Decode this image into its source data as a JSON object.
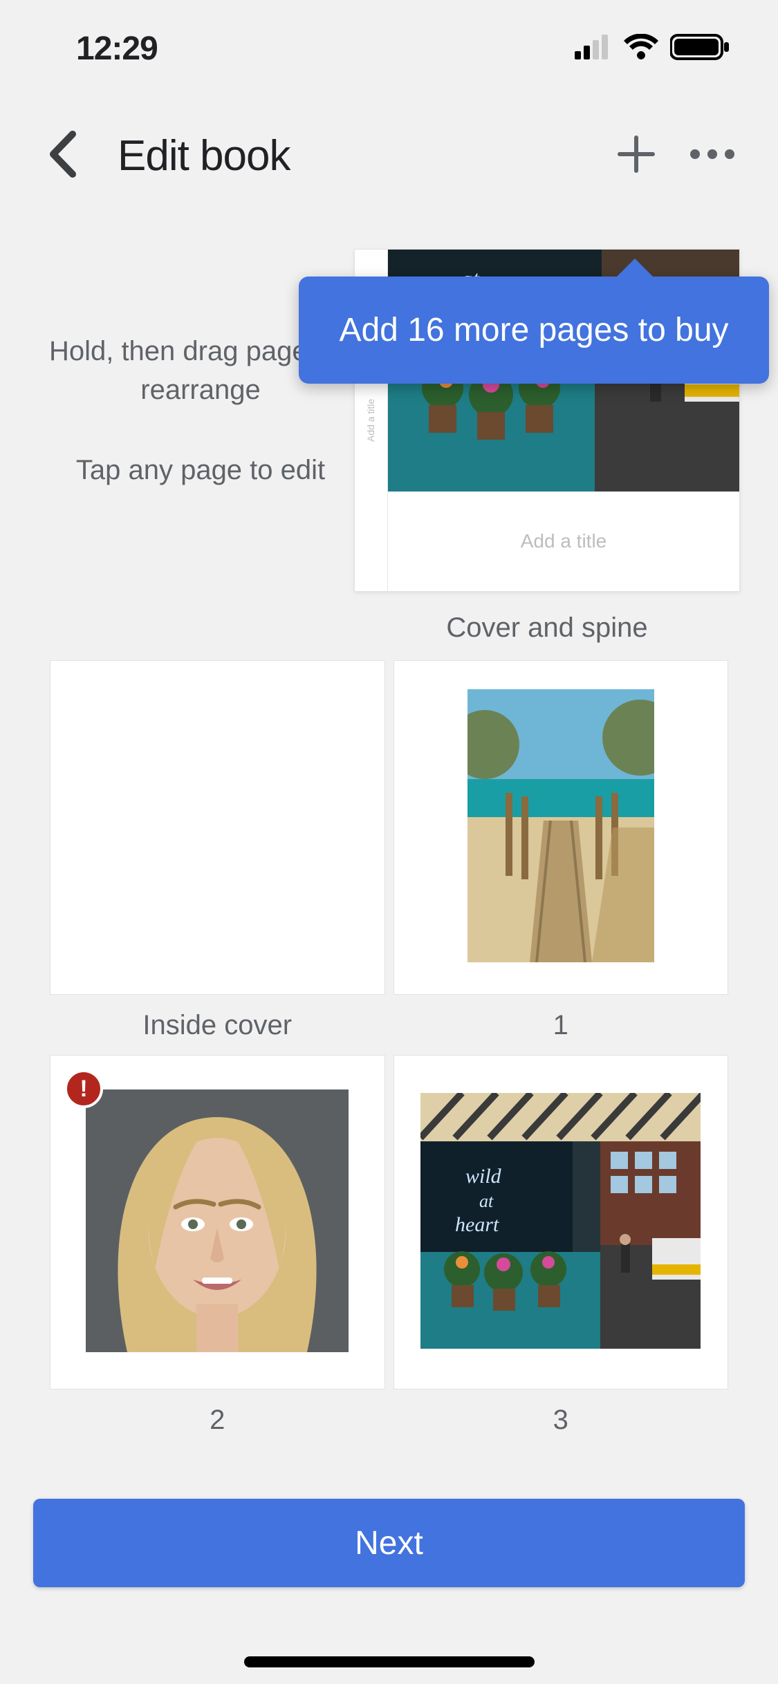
{
  "status": {
    "time": "12:29"
  },
  "header": {
    "title": "Edit book"
  },
  "tooltip": {
    "text": "Add 16 more pages to buy"
  },
  "instructions": {
    "drag": "Hold, then drag pages to rearrange",
    "tap": "Tap any page to edit"
  },
  "cover": {
    "spine_placeholder": "Add a title",
    "title_placeholder": "Add a title",
    "caption": "Cover and spine"
  },
  "pages": {
    "inside_cover": {
      "caption": "Inside cover"
    },
    "p1": {
      "caption": "1"
    },
    "p2": {
      "caption": "2",
      "warning": "!"
    },
    "p3": {
      "caption": "3"
    }
  },
  "footer": {
    "next": "Next"
  }
}
